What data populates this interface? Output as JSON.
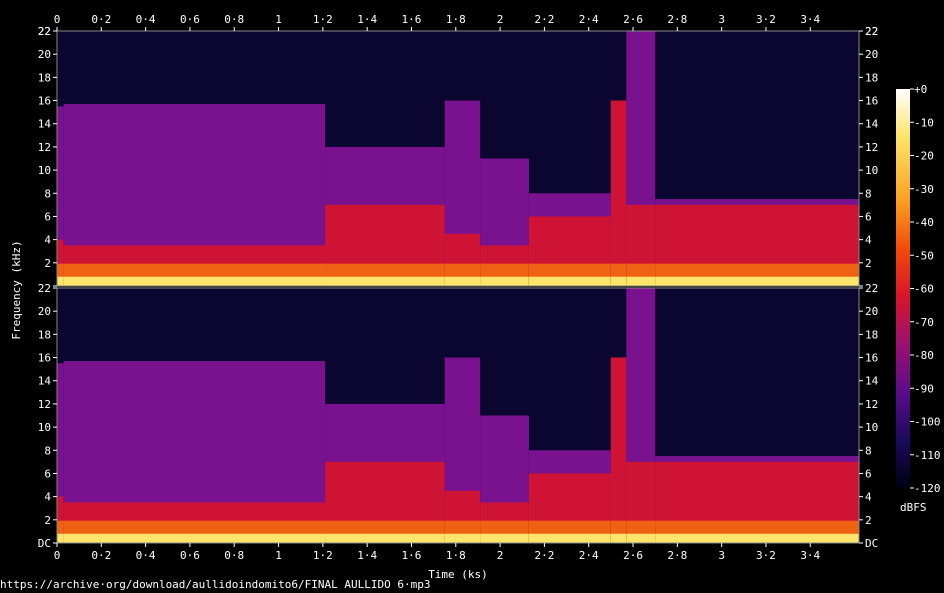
{
  "chart_data": {
    "type": "heatmap",
    "xlabel": "Time (ks)",
    "ylabel": "Frequency (kHz)",
    "x_ticks": [
      "0",
      "0·2",
      "0·4",
      "0·6",
      "0·8",
      "1",
      "1·2",
      "1·4",
      "1·6",
      "1·8",
      "2",
      "2·2",
      "2·4",
      "2·6",
      "2·8",
      "3",
      "3·2",
      "3·4"
    ],
    "x_tick_values": [
      0,
      0.2,
      0.4,
      0.6,
      0.8,
      1.0,
      1.2,
      1.4,
      1.6,
      1.8,
      2.0,
      2.2,
      2.4,
      2.6,
      2.8,
      3.0,
      3.2,
      3.4
    ],
    "xlim": [
      0,
      3.62
    ],
    "y_ticks_top": [
      "2",
      "4",
      "6",
      "8",
      "10",
      "12",
      "14",
      "16",
      "18",
      "20",
      "22"
    ],
    "y_ticks_bottom": [
      "DC",
      "2",
      "4",
      "6",
      "8",
      "10",
      "12",
      "14",
      "16",
      "18",
      "20"
    ],
    "y_tick_values": [
      0,
      2,
      4,
      6,
      8,
      10,
      12,
      14,
      16,
      18,
      20,
      22
    ],
    "ylim": [
      0,
      22
    ],
    "colorbar": {
      "label": "dBFS",
      "ticks": [
        "+0",
        "-10",
        "-20",
        "-30",
        "-40",
        "-50",
        "-60",
        "-70",
        "-80",
        "-90",
        "-100",
        "-110",
        "-120"
      ],
      "tick_values": [
        0,
        -10,
        -20,
        -30,
        -40,
        -50,
        -60,
        -70,
        -80,
        -90,
        -100,
        -110,
        -120
      ],
      "range": [
        -120,
        0
      ]
    },
    "channels": 2,
    "segments": [
      {
        "start": 0,
        "end": 0.03,
        "cutoff_khz": 15.5,
        "loud_khz": 4
      },
      {
        "start": 0.03,
        "end": 1.21,
        "cutoff_khz": 15.7,
        "loud_khz": 3.5
      },
      {
        "start": 1.21,
        "end": 1.75,
        "cutoff_khz": 12,
        "loud_khz": 7
      },
      {
        "start": 1.75,
        "end": 1.91,
        "cutoff_khz": 16,
        "loud_khz": 4.5
      },
      {
        "start": 1.91,
        "end": 2.13,
        "cutoff_khz": 11,
        "loud_khz": 3.5
      },
      {
        "start": 2.13,
        "end": 2.5,
        "cutoff_khz": 8,
        "loud_khz": 6
      },
      {
        "start": 2.5,
        "end": 2.57,
        "cutoff_khz": 16,
        "loud_khz": 16
      },
      {
        "start": 2.57,
        "end": 2.7,
        "cutoff_khz": 22,
        "loud_khz": 7
      },
      {
        "start": 2.7,
        "end": 3.62,
        "cutoff_khz": 7.5,
        "loud_khz": 7
      }
    ]
  },
  "colors": {
    "background": "#000000",
    "axis": "#ffffff",
    "palette": [
      "#000010",
      "#1b0a5c",
      "#5a0c8a",
      "#9a1070",
      "#d8142a",
      "#f24b0a",
      "#fba020",
      "#fde46a",
      "#ffffff"
    ]
  },
  "footer_url": "https://archive·org/download/aullidoindomito6/FINAL AULLIDO 6·mp3"
}
